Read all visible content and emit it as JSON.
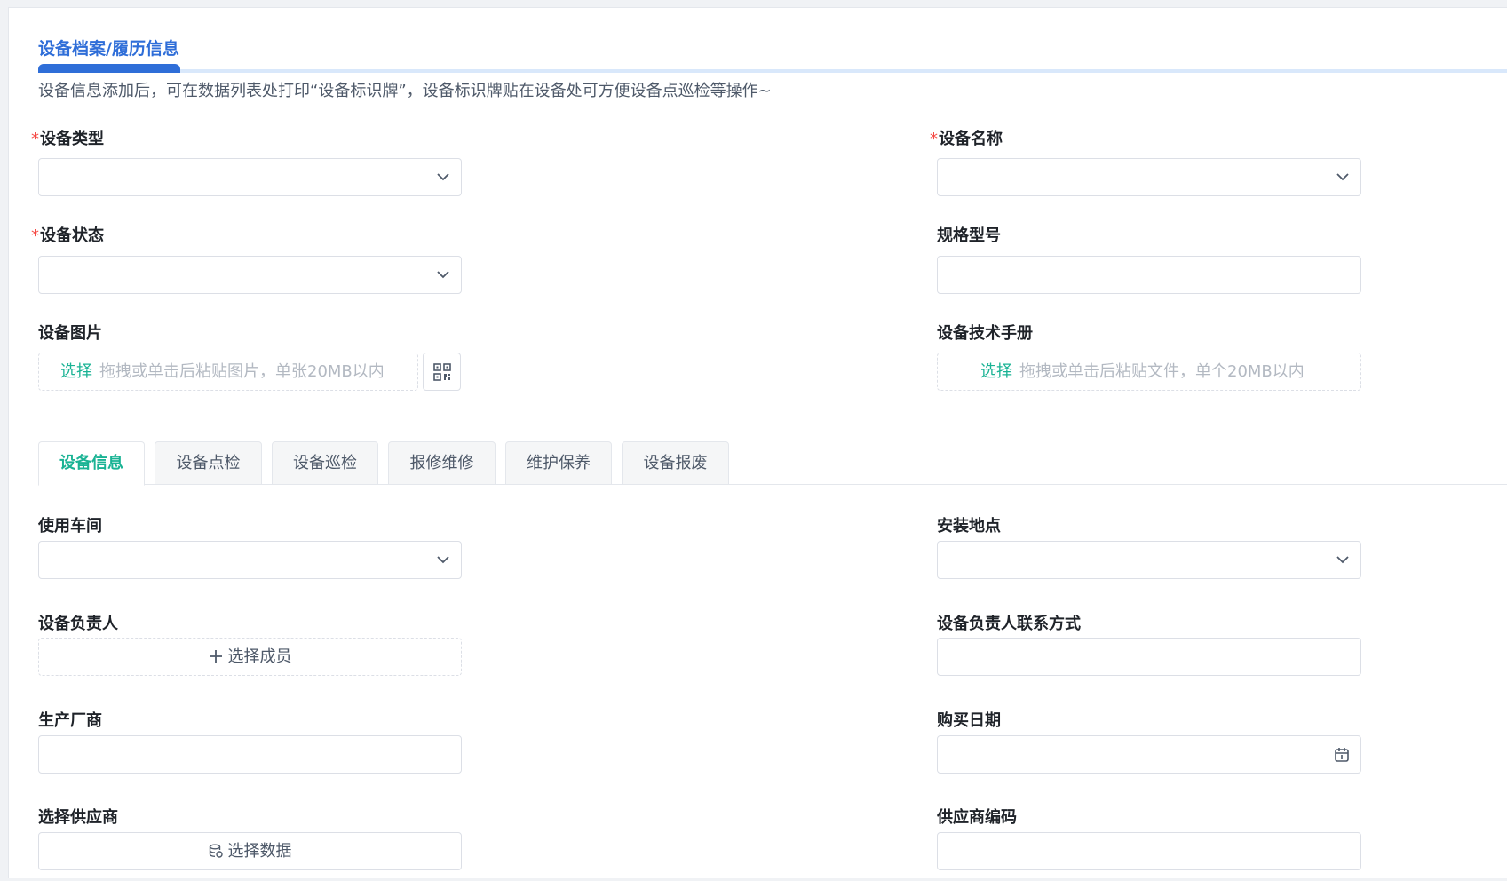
{
  "header": {
    "title": "设备档案/履历信息",
    "hint": "设备信息添加后，可在数据列表处打印“设备标识牌”，设备标识牌贴在设备处可方便设备点巡检等操作~"
  },
  "form": {
    "device_type_label": "设备类型",
    "device_name_label": "设备名称",
    "device_status_label": "设备状态",
    "spec_model_label": "规格型号",
    "device_image_label": "设备图片",
    "device_manual_label": "设备技术手册",
    "required_mark": "*",
    "image_upload": {
      "pick": "选择",
      "placeholder": "拖拽或单击后粘贴图片，单张20MB以内"
    },
    "manual_upload": {
      "pick": "选择",
      "placeholder": "拖拽或单击后粘贴文件，单个20MB以内"
    }
  },
  "tabs": [
    "设备信息",
    "设备点检",
    "设备巡检",
    "报修维修",
    "维护保养",
    "设备报废"
  ],
  "active_tab": "设备信息",
  "detail": {
    "workshop_label": "使用车间",
    "location_label": "安装地点",
    "owner_label": "设备负责人",
    "owner_button": "选择成员",
    "owner_contact_label": "设备负责人联系方式",
    "manufacturer_label": "生产厂商",
    "purchase_date_label": "购买日期",
    "supplier_label": "选择供应商",
    "supplier_button": "选择数据",
    "supplier_code_label": "供应商编码"
  },
  "colors": {
    "accent": "#2f6ed8",
    "tab_active": "#1ab394",
    "required": "#f54a45"
  },
  "icons": [
    "chevron-down-icon",
    "qrcode-icon",
    "plus-icon",
    "calendar-icon",
    "database-icon"
  ]
}
